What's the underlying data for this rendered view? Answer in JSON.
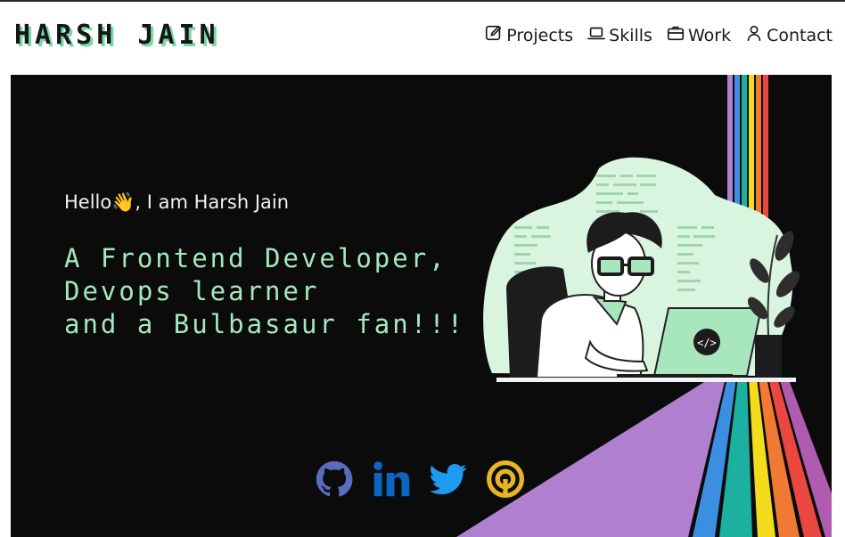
{
  "brand": {
    "name": "HARSH JAIN"
  },
  "nav": {
    "items": [
      {
        "label": "Projects",
        "icon": "edit-icon"
      },
      {
        "label": "Skills",
        "icon": "laptop-icon"
      },
      {
        "label": "Work",
        "icon": "briefcase-icon"
      },
      {
        "label": "Contact",
        "icon": "person-icon"
      }
    ]
  },
  "hero": {
    "greeting": "Hello👋, I am Harsh Jain",
    "tagline": [
      "A Frontend Developer,",
      "Devops learner",
      "and a Bulbasaur fan!!!"
    ],
    "illustration_code_glyph": "</>"
  },
  "social": [
    {
      "icon": "github-icon",
      "color": "#5b6bbf"
    },
    {
      "icon": "linkedin-icon",
      "color": "#0a66c2"
    },
    {
      "icon": "twitter-icon",
      "color": "#1d9bf0"
    },
    {
      "icon": "hashnode-icon",
      "color": "#e8b620"
    }
  ],
  "colors": {
    "accent_green": "#a4e8bd",
    "hero_background": "#0b0b0b",
    "rainbow": [
      "#b07fd0",
      "#3c8fe0",
      "#1bb0a0",
      "#f3dc1b",
      "#f07a33",
      "#e9473f",
      "#b05bb0"
    ]
  }
}
